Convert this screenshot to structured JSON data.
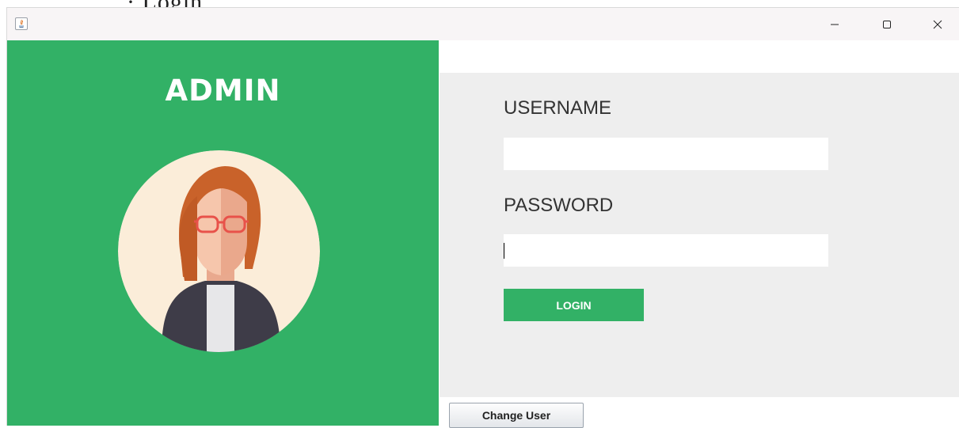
{
  "window": {
    "controls": {
      "minimize": "—",
      "maximize": "☐",
      "close": "✕"
    }
  },
  "left": {
    "title": "ADMIN"
  },
  "form": {
    "username_label": "USERNAME",
    "username_value": "",
    "password_label": "PASSWORD",
    "password_value": "",
    "login_label": "LOGIN"
  },
  "footer": {
    "change_user_label": "Change User"
  },
  "colors": {
    "accent_green": "#32b166",
    "panel_gray": "#eeeeee",
    "avatar_bg": "#fbedd9",
    "hair": "#c9622a",
    "glasses": "#e8524a",
    "jacket": "#3e3c48"
  },
  "icons": {
    "app": "java-app-icon",
    "avatar": "woman-with-glasses-avatar"
  }
}
